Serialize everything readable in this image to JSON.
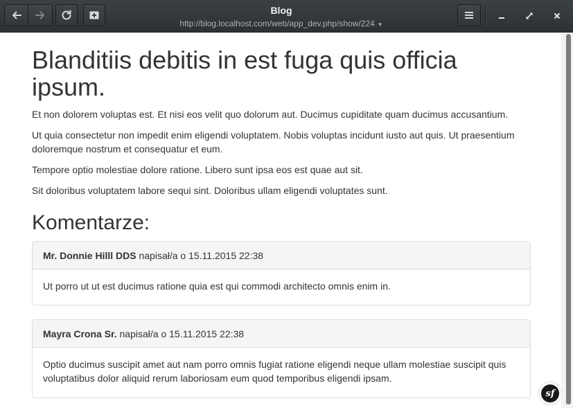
{
  "window": {
    "title": "Blog",
    "url": "http://blog.localhost.com/web/app_dev.php/show/224",
    "url_dropdown_icon": "caret-down",
    "icons": [
      "back-arrow",
      "forward-arrow",
      "reload",
      "bookmark-add",
      "hamburger-menu",
      "minimize",
      "maximize",
      "close"
    ]
  },
  "post": {
    "title": "Blanditiis debitis in est fuga quis officia ipsum.",
    "paragraphs": [
      "Et non dolorem voluptas est. Et nisi eos velit quo dolorum aut. Ducimus cupiditate quam ducimus accusantium.",
      "Ut quia consectetur non impedit enim eligendi voluptatem. Nobis voluptas incidunt iusto aut quis. Ut praesentium doloremque nostrum et consequatur et eum.",
      "Tempore optio molestiae dolore ratione. Libero sunt ipsa eos est quae aut sit.",
      "Sit doloribus voluptatem labore sequi sint. Doloribus ullam eligendi voluptates sunt."
    ]
  },
  "comments_section": {
    "title": "Komentarze:",
    "comments": [
      {
        "author": "Mr. Donnie Hilll DDS",
        "meta": "napisał/a o 15.11.2015 22:38",
        "body": "Ut porro ut ut est ducimus ratione quia est qui commodi architecto omnis enim in."
      },
      {
        "author": "Mayra Crona Sr.",
        "meta": "napisał/a o 15.11.2015 22:38",
        "body": "Optio ducimus suscipit amet aut nam porro omnis fugiat ratione eligendi neque ullam molestiae suscipit quis voluptatibus dolor aliquid rerum laboriosam eum quod temporibus eligendi ipsam."
      }
    ]
  },
  "debug_toolbar": {
    "logo_text": "sf"
  }
}
